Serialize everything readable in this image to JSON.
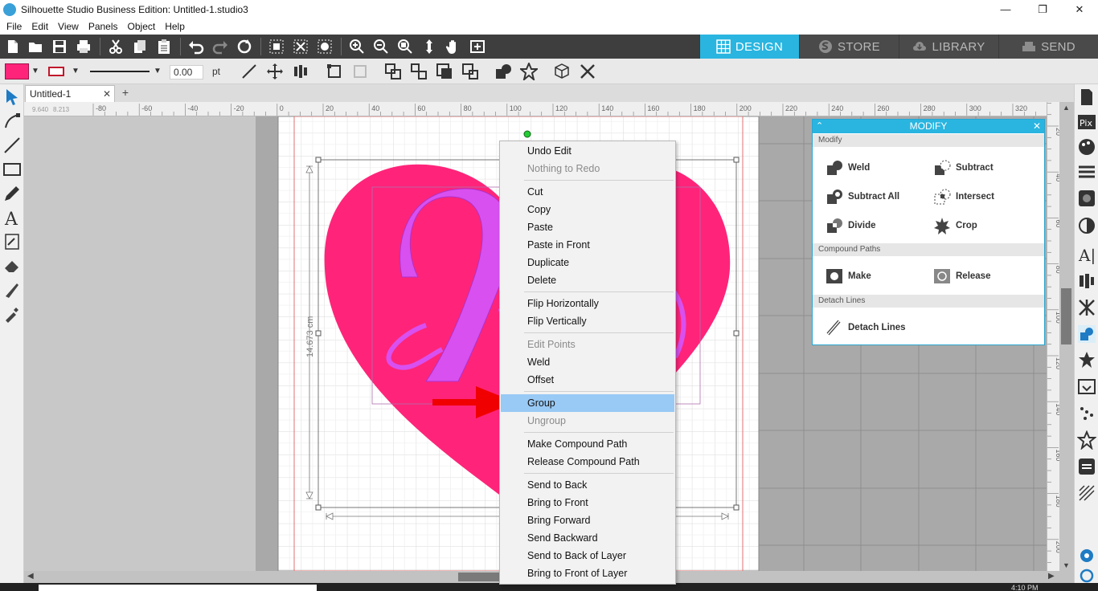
{
  "window": {
    "title": "Silhouette Studio Business Edition: Untitled-1.studio3",
    "minimize": "—",
    "maximize": "❐",
    "close": "✕"
  },
  "menu": [
    "File",
    "Edit",
    "View",
    "Panels",
    "Object",
    "Help"
  ],
  "nav_tabs": [
    {
      "label": "DESIGN",
      "active": true,
      "icon": "design-grid-icon"
    },
    {
      "label": "STORE",
      "active": false,
      "icon": "store-icon"
    },
    {
      "label": "LIBRARY",
      "active": false,
      "icon": "library-cloud-icon"
    },
    {
      "label": "SEND",
      "active": false,
      "icon": "send-cutter-icon"
    }
  ],
  "line_toolbar": {
    "fill_color": "#ff2479",
    "line_color": "#c0182b",
    "line_width": "0.00",
    "unit": "pt",
    "arrow": "▼"
  },
  "doc_tabs": [
    {
      "label": "Untitled-1",
      "close": "✕"
    }
  ],
  "add_tab": "+",
  "rulers": {
    "h_ticks": [
      "-80",
      "-60",
      "-40",
      "-20",
      "0",
      "20",
      "40",
      "60",
      "80",
      "100",
      "120",
      "140",
      "160",
      "180",
      "200",
      "220",
      "240",
      "260",
      "280",
      "300",
      "320"
    ],
    "v_ticks": [
      "20",
      "40",
      "60",
      "80",
      "100",
      "120",
      "140",
      "160",
      "180",
      "200"
    ],
    "coords": [
      "9.640",
      "8.213"
    ]
  },
  "canvas": {
    "heart_color": "#ff2479",
    "text_color": "#d850f0",
    "dimension_label": "14.673 cm"
  },
  "context_menu": {
    "groups": [
      [
        {
          "label": "Undo Edit",
          "enabled": true
        },
        {
          "label": "Nothing to Redo",
          "enabled": false
        }
      ],
      [
        {
          "label": "Cut",
          "enabled": true
        },
        {
          "label": "Copy",
          "enabled": true
        },
        {
          "label": "Paste",
          "enabled": true
        },
        {
          "label": "Paste in Front",
          "enabled": true
        },
        {
          "label": "Duplicate",
          "enabled": true
        },
        {
          "label": "Delete",
          "enabled": true
        }
      ],
      [
        {
          "label": "Flip Horizontally",
          "enabled": true
        },
        {
          "label": "Flip Vertically",
          "enabled": true
        }
      ],
      [
        {
          "label": "Edit Points",
          "enabled": false
        },
        {
          "label": "Weld",
          "enabled": true
        },
        {
          "label": "Offset",
          "enabled": true
        }
      ],
      [
        {
          "label": "Group",
          "enabled": true,
          "highlighted": true
        },
        {
          "label": "Ungroup",
          "enabled": false
        }
      ],
      [
        {
          "label": "Make Compound Path",
          "enabled": true
        },
        {
          "label": "Release Compound Path",
          "enabled": true
        }
      ],
      [
        {
          "label": "Send to Back",
          "enabled": true
        },
        {
          "label": "Bring to Front",
          "enabled": true
        },
        {
          "label": "Bring Forward",
          "enabled": true
        },
        {
          "label": "Send Backward",
          "enabled": true
        },
        {
          "label": "Send to Back of Layer",
          "enabled": true
        },
        {
          "label": "Bring to Front of Layer",
          "enabled": true
        }
      ]
    ]
  },
  "modify_panel": {
    "title": "MODIFY",
    "collapse": "⌃",
    "close": "✕",
    "sections": {
      "modify": {
        "label": "Modify",
        "buttons": [
          "Weld",
          "Subtract",
          "Subtract All",
          "Intersect",
          "Divide",
          "Crop"
        ]
      },
      "compound": {
        "label": "Compound Paths",
        "buttons": [
          "Make",
          "Release"
        ]
      },
      "detach": {
        "label": "Detach Lines",
        "buttons": [
          "Detach Lines"
        ]
      }
    }
  },
  "taskbar": {
    "clock": "4:10 PM"
  }
}
